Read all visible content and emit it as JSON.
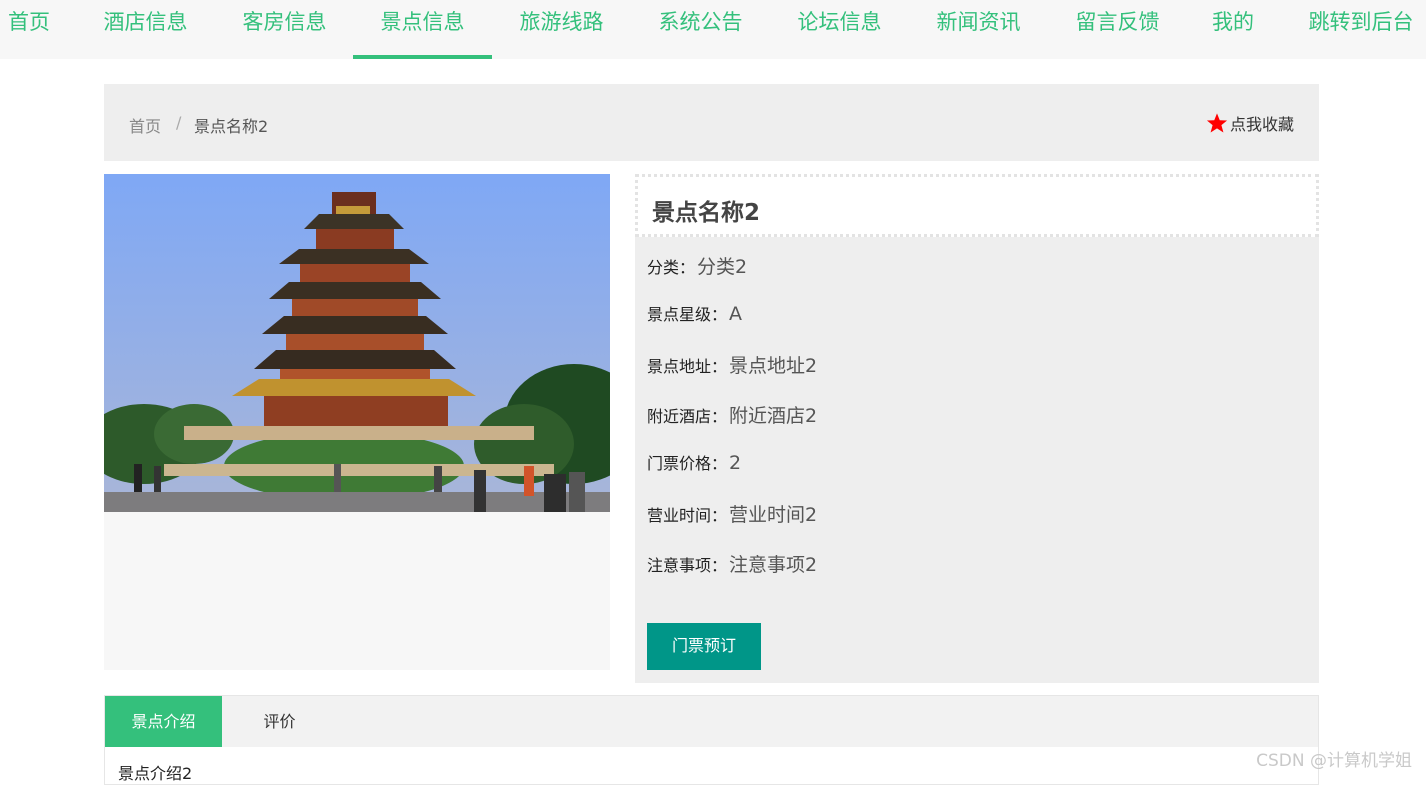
{
  "nav": {
    "items": [
      "首页",
      "酒店信息",
      "客房信息",
      "景点信息",
      "旅游线路",
      "系统公告",
      "论坛信息",
      "新闻资讯",
      "留言反馈",
      "我的",
      "跳转到后台"
    ],
    "active_index": 3,
    "accent_color": "#34c07c"
  },
  "breadcrumb": {
    "home": "首页",
    "separator": "/",
    "current": "景点名称2"
  },
  "favorite": {
    "label": "点我收藏",
    "icon": "star-icon",
    "icon_color": "#ff0000"
  },
  "spot": {
    "title": "景点名称2",
    "fields": [
      {
        "label": "分类：",
        "value": "分类2"
      },
      {
        "label": "景点星级：",
        "value": "A"
      },
      {
        "label": "景点地址：",
        "value": "景点地址2"
      },
      {
        "label": "附近酒店：",
        "value": "附近酒店2"
      },
      {
        "label": "门票价格：",
        "value": "2"
      },
      {
        "label": "营业时间：",
        "value": "营业时间2"
      },
      {
        "label": "注意事项：",
        "value": "注意事项2"
      }
    ],
    "book_button": "门票预订",
    "book_button_color": "#009688"
  },
  "tabs": {
    "items": [
      "景点介绍",
      "评价"
    ],
    "active_index": 0,
    "content": "景点介绍2"
  },
  "watermark": "CSDN @计算机学姐"
}
